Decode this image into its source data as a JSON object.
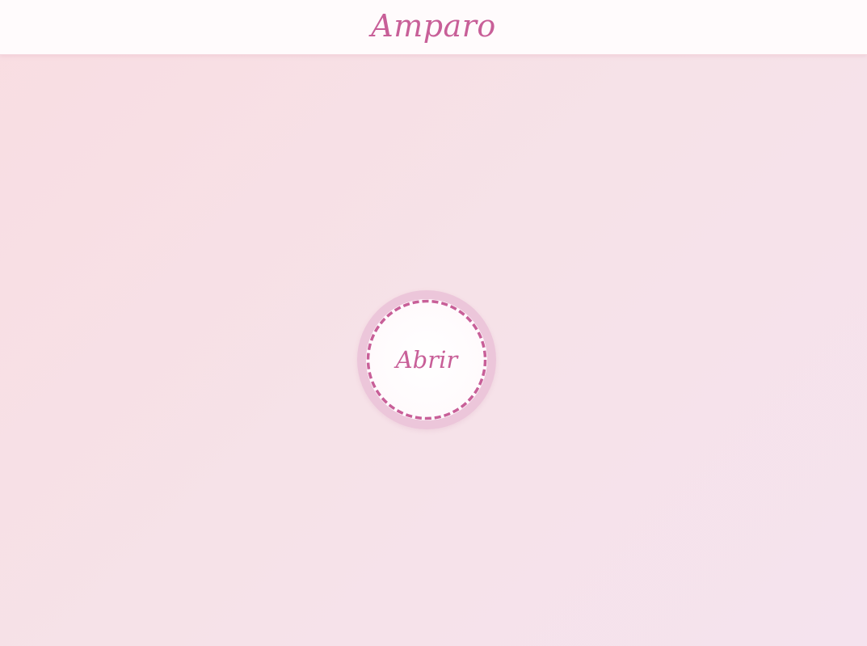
{
  "header": {
    "brand": "Amparo"
  },
  "main": {
    "open_button_label": "Abrir"
  },
  "colors": {
    "accent": "#c85f98",
    "seal_ring": "#ecc6da",
    "header_bg": "#fffbfc",
    "background": "#f6e2e8"
  }
}
